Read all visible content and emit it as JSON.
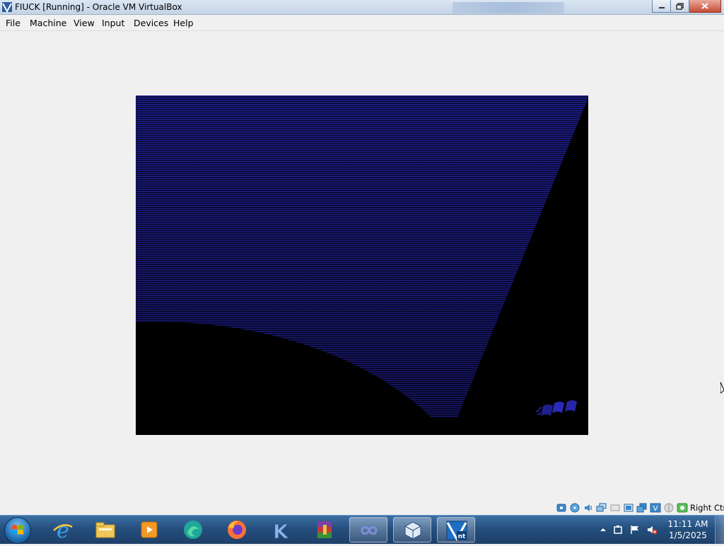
{
  "window": {
    "title": "FIUCK [Running] - Oracle VM VirtualBox"
  },
  "menu": [
    "File",
    "Machine",
    "View",
    "Input",
    "Devices",
    "Help"
  ],
  "status_bar": {
    "host_key": "Right Ctrl",
    "icons": [
      "hard-disk-icon",
      "optical-drive-icon",
      "audio-icon",
      "network-icon",
      "usb-icon",
      "shared-folders-icon",
      "display-icon",
      "video-capture-icon",
      "mouse-integration-icon",
      "keyboard-capture-icon"
    ]
  },
  "taskbar": {
    "items": [
      "internet-explorer-icon",
      "file-explorer-icon",
      "media-player-icon",
      "edge-icon",
      "firefox-icon",
      "k-app-icon",
      "winrar-icon",
      "infinity-app-icon",
      "virtualbox-icon",
      "vm-nt-icon"
    ],
    "active_item": "vm-nt-icon"
  },
  "tray": {
    "time": "11:11 AM",
    "date": "1/5/2025"
  },
  "colors": {
    "vm_blue": "#1a1a8c",
    "taskbar": "#254f7e"
  }
}
